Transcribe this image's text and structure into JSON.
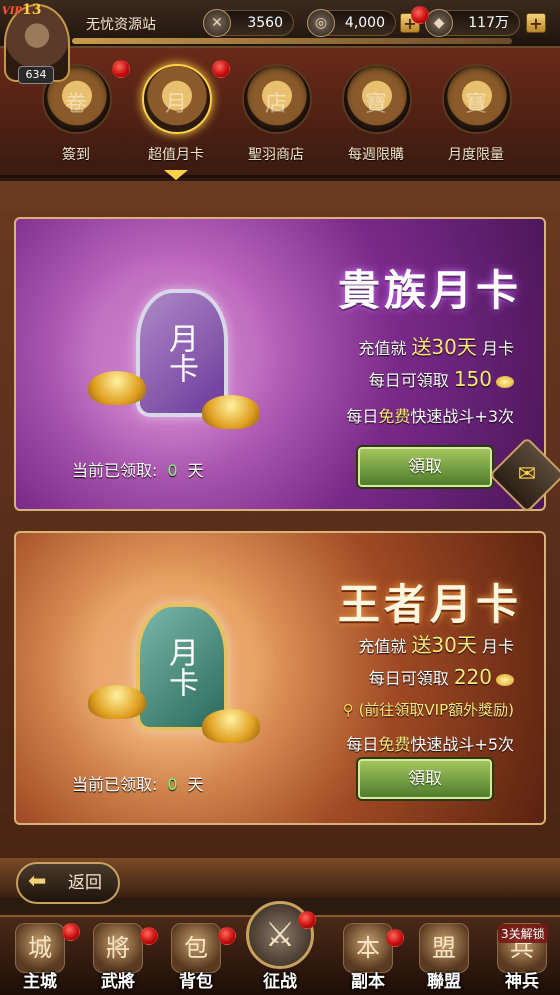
{
  "player": {
    "vip_label": "VIP",
    "vip_level": "13",
    "level": "634",
    "name": "无忧资源站"
  },
  "resources": {
    "power": "3560",
    "copper": "4,000",
    "gold": "117万"
  },
  "tabs": [
    {
      "label": "簽到",
      "icon": "scroll-icon",
      "glyph": "卷",
      "active": false
    },
    {
      "label": "超值月卡",
      "icon": "month-card-icon",
      "glyph": "月",
      "active": true
    },
    {
      "label": "聖羽商店",
      "icon": "shop-icon",
      "glyph": "店",
      "active": false
    },
    {
      "label": "每週限購",
      "icon": "treasure-chest-icon",
      "glyph": "寶",
      "active": false
    },
    {
      "label": "月度限量",
      "icon": "treasure-pile-icon",
      "glyph": "寶",
      "active": false
    }
  ],
  "cards": {
    "noble": {
      "title": "貴族月卡",
      "emblem": "月卡",
      "recharge_prefix": "充值就",
      "recharge_highlight": "送30天",
      "recharge_suffix": "月卡",
      "daily_prefix": "每日可領取",
      "daily_amount": "150",
      "battle_prefix": "每日",
      "battle_free": "免费",
      "battle_suffix": "快速战斗+3次",
      "claimed_label": "当前已领取:",
      "claimed_days": "0",
      "claimed_unit": "天",
      "button": "領取"
    },
    "king": {
      "title": "王者月卡",
      "emblem": "月卡",
      "recharge_prefix": "充值就",
      "recharge_highlight": "送30天",
      "recharge_suffix": "月卡",
      "daily_prefix": "每日可領取",
      "daily_amount": "220",
      "vip_link": "(前往領取VIP額外獎励)",
      "battle_prefix": "每日",
      "battle_free": "免费",
      "battle_suffix": "快速战斗+5次",
      "claimed_label": "当前已领取:",
      "claimed_days": "0",
      "claimed_unit": "天",
      "button": "領取"
    }
  },
  "back_label": "返回",
  "nav": [
    {
      "label": "主城",
      "icon": "city-icon",
      "glyph": "城"
    },
    {
      "label": "武將",
      "icon": "general-icon",
      "glyph": "將"
    },
    {
      "label": "背包",
      "icon": "bag-icon",
      "glyph": "包"
    },
    {
      "label": "征战",
      "icon": "crossed-swords-icon",
      "glyph": "⚔"
    },
    {
      "label": "副本",
      "icon": "dungeon-icon",
      "glyph": "本"
    },
    {
      "label": "聯盟",
      "icon": "alliance-icon",
      "glyph": "盟"
    },
    {
      "label": "神兵",
      "icon": "weapon-icon",
      "glyph": "兵"
    }
  ],
  "unlock_text": "3关解锁",
  "colors": {
    "accent_gold": "#ffd24a",
    "highlight_yellow": "#ffe87a",
    "free_green": "#7aff7a",
    "notification_red": "#c40a0a"
  }
}
